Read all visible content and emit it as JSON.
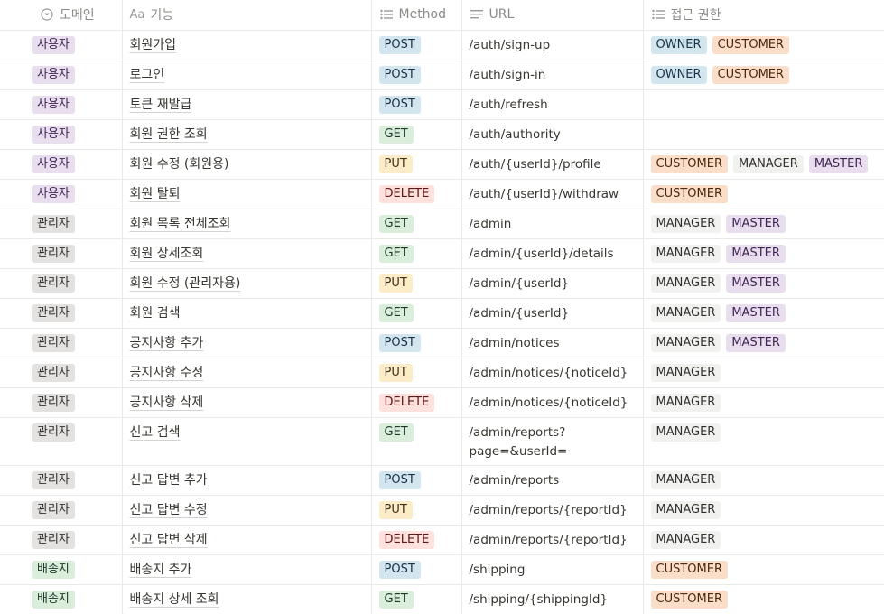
{
  "headers": {
    "domain": "도메인",
    "feature": "기능",
    "feature_prefix": "Aa",
    "method": "Method",
    "url": "URL",
    "access": "접근 권한"
  },
  "colors": {
    "사용자": "purple",
    "관리자": "gray",
    "배송지": "green",
    "POST": "blue",
    "GET": "green",
    "PUT": "yellow",
    "DELETE": "red",
    "OWNER": "blue",
    "CUSTOMER": "orange",
    "MANAGER": "lightgray",
    "MASTER": "purple"
  },
  "rows": [
    {
      "domain": "사용자",
      "feature": "회원가입",
      "method": "POST",
      "url": "/auth/sign-up",
      "access": [
        "OWNER",
        "CUSTOMER"
      ]
    },
    {
      "domain": "사용자",
      "feature": "로그인",
      "method": "POST",
      "url": "/auth/sign-in",
      "access": [
        "OWNER",
        "CUSTOMER"
      ]
    },
    {
      "domain": "사용자",
      "feature": "토큰 재발급",
      "method": "POST",
      "url": "/auth/refresh",
      "access": []
    },
    {
      "domain": "사용자",
      "feature": "회원 권한 조회",
      "method": "GET",
      "url": "/auth/authority",
      "access": []
    },
    {
      "domain": "사용자",
      "feature": "회원 수정 (회원용)",
      "method": "PUT",
      "url": "/auth/{userId}/profile",
      "access": [
        "CUSTOMER",
        "MANAGER",
        "MASTER"
      ]
    },
    {
      "domain": "사용자",
      "feature": "회원 탈퇴",
      "method": "DELETE",
      "url": "/auth/{userId}/withdraw",
      "access": [
        "CUSTOMER"
      ]
    },
    {
      "domain": "관리자",
      "feature": "회원 목록 전체조회",
      "method": "GET",
      "url": "/admin",
      "access": [
        "MANAGER",
        "MASTER"
      ]
    },
    {
      "domain": "관리자",
      "feature": "회원 상세조회",
      "method": "GET",
      "url": "/admin/{userId}/details",
      "access": [
        "MANAGER",
        "MASTER"
      ]
    },
    {
      "domain": "관리자",
      "feature": "회원 수정 (관리자용)",
      "method": "PUT",
      "url": "/admin/{userId}",
      "access": [
        "MANAGER",
        "MASTER"
      ]
    },
    {
      "domain": "관리자",
      "feature": "회원 검색",
      "method": "GET",
      "url": "/admin/{userId}",
      "access": [
        "MANAGER",
        "MASTER"
      ]
    },
    {
      "domain": "관리자",
      "feature": "공지사항 추가",
      "method": "POST",
      "url": "/admin/notices",
      "access": [
        "MANAGER",
        "MASTER"
      ]
    },
    {
      "domain": "관리자",
      "feature": "공지사항 수정",
      "method": "PUT",
      "url": "/admin/notices/{noticeId}",
      "access": [
        "MANAGER"
      ]
    },
    {
      "domain": "관리자",
      "feature": "공지사항 삭제",
      "method": "DELETE",
      "url": "/admin/notices/{noticeId}",
      "access": [
        "MANAGER"
      ]
    },
    {
      "domain": "관리자",
      "feature": "신고 검색",
      "method": "GET",
      "url": "/admin/reports?page=&userId=",
      "access": [
        "MANAGER"
      ]
    },
    {
      "domain": "관리자",
      "feature": "신고 답변 추가",
      "method": "POST",
      "url": "/admin/reports",
      "access": [
        "MANAGER"
      ]
    },
    {
      "domain": "관리자",
      "feature": "신고 답변 수정",
      "method": "PUT",
      "url": "/admin/reports/{reportId}",
      "access": [
        "MANAGER"
      ]
    },
    {
      "domain": "관리자",
      "feature": "신고 답변 삭제",
      "method": "DELETE",
      "url": "/admin/reports/{reportId}",
      "access": [
        "MANAGER"
      ]
    },
    {
      "domain": "배송지",
      "feature": "배송지 추가",
      "method": "POST",
      "url": "/shipping",
      "access": [
        "CUSTOMER"
      ]
    },
    {
      "domain": "배송지",
      "feature": "배송지 상세 조회",
      "method": "GET",
      "url": "/shipping/{shippingId}",
      "access": [
        "CUSTOMER"
      ]
    }
  ]
}
